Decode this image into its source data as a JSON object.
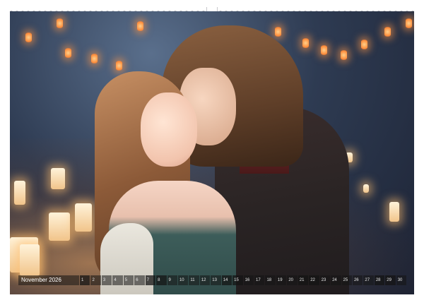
{
  "calendar": {
    "month_label": "November 2026",
    "days": [
      "1",
      "2",
      "3",
      "4",
      "5",
      "6",
      "7",
      "8",
      "9",
      "10",
      "11",
      "12",
      "13",
      "14",
      "15",
      "16",
      "17",
      "18",
      "19",
      "20",
      "21",
      "22",
      "23",
      "24",
      "25",
      "26",
      "27",
      "28",
      "29",
      "30"
    ]
  },
  "colors": {
    "page_background": "#ffffff",
    "binding_holes": "#b9b9bd",
    "lantern_glow": "#ff8c3a"
  }
}
